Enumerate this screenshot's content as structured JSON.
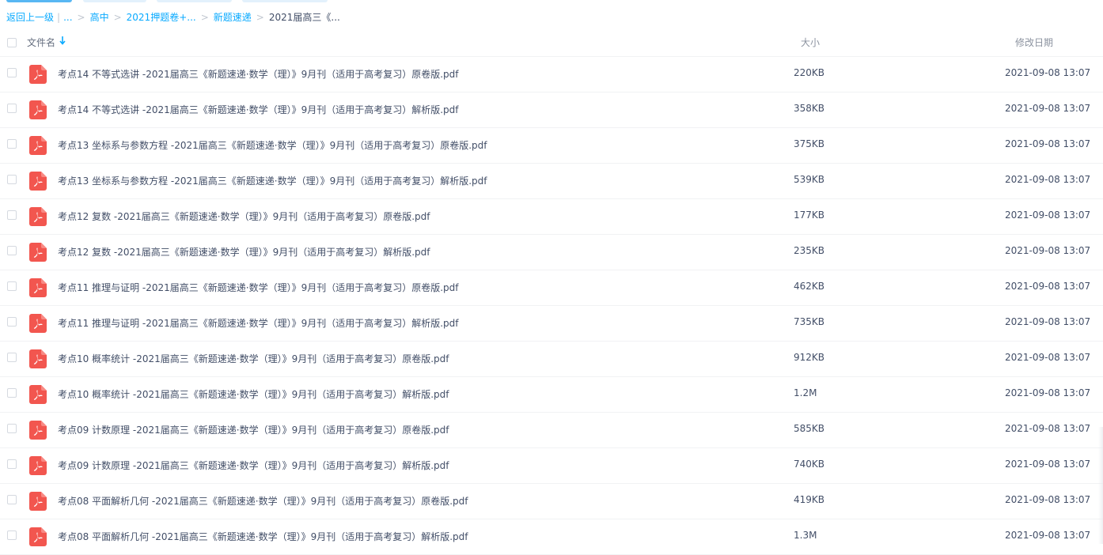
{
  "breadcrumb": {
    "back": "返回上一级",
    "ellipsis": "...",
    "items": [
      "高中",
      "2021押题卷+...",
      "新题速递"
    ],
    "current": "2021届高三《..."
  },
  "header": {
    "name": "文件名",
    "size": "大小",
    "date": "修改日期"
  },
  "colors": {
    "link": "#09aaff",
    "pdf_icon": "#f2564f",
    "text": "#424e67"
  },
  "files": [
    {
      "name": "考点14 不等式选讲 -2021届高三《新题速递·数学（理）》9月刊（适用于高考复习）原卷版.pdf",
      "size": "220KB",
      "date": "2021-09-08 13:07"
    },
    {
      "name": "考点14 不等式选讲 -2021届高三《新题速递·数学（理）》9月刊（适用于高考复习）解析版.pdf",
      "size": "358KB",
      "date": "2021-09-08 13:07"
    },
    {
      "name": "考点13 坐标系与参数方程 -2021届高三《新题速递·数学（理）》9月刊（适用于高考复习）原卷版.pdf",
      "size": "375KB",
      "date": "2021-09-08 13:07"
    },
    {
      "name": "考点13 坐标系与参数方程 -2021届高三《新题速递·数学（理）》9月刊（适用于高考复习）解析版.pdf",
      "size": "539KB",
      "date": "2021-09-08 13:07"
    },
    {
      "name": "考点12 复数 -2021届高三《新题速递·数学（理）》9月刊（适用于高考复习）原卷版.pdf",
      "size": "177KB",
      "date": "2021-09-08 13:07"
    },
    {
      "name": "考点12 复数 -2021届高三《新题速递·数学（理）》9月刊（适用于高考复习）解析版.pdf",
      "size": "235KB",
      "date": "2021-09-08 13:07"
    },
    {
      "name": "考点11 推理与证明 -2021届高三《新题速递·数学（理）》9月刊（适用于高考复习）原卷版.pdf",
      "size": "462KB",
      "date": "2021-09-08 13:07"
    },
    {
      "name": "考点11 推理与证明 -2021届高三《新题速递·数学（理）》9月刊（适用于高考复习）解析版.pdf",
      "size": "735KB",
      "date": "2021-09-08 13:07"
    },
    {
      "name": "考点10 概率统计 -2021届高三《新题速递·数学（理）》9月刊（适用于高考复习）原卷版.pdf",
      "size": "912KB",
      "date": "2021-09-08 13:07"
    },
    {
      "name": "考点10 概率统计 -2021届高三《新题速递·数学（理）》9月刊（适用于高考复习）解析版.pdf",
      "size": "1.2M",
      "date": "2021-09-08 13:07"
    },
    {
      "name": "考点09 计数原理 -2021届高三《新题速递·数学（理）》9月刊（适用于高考复习）原卷版.pdf",
      "size": "585KB",
      "date": "2021-09-08 13:07"
    },
    {
      "name": "考点09 计数原理 -2021届高三《新题速递·数学（理）》9月刊（适用于高考复习）解析版.pdf",
      "size": "740KB",
      "date": "2021-09-08 13:07"
    },
    {
      "name": "考点08 平面解析几何 -2021届高三《新题速递·数学（理）》9月刊（适用于高考复习）原卷版.pdf",
      "size": "419KB",
      "date": "2021-09-08 13:07"
    },
    {
      "name": "考点08 平面解析几何 -2021届高三《新题速递·数学（理）》9月刊（适用于高考复习）解析版.pdf",
      "size": "1.3M",
      "date": "2021-09-08 13:07"
    }
  ]
}
